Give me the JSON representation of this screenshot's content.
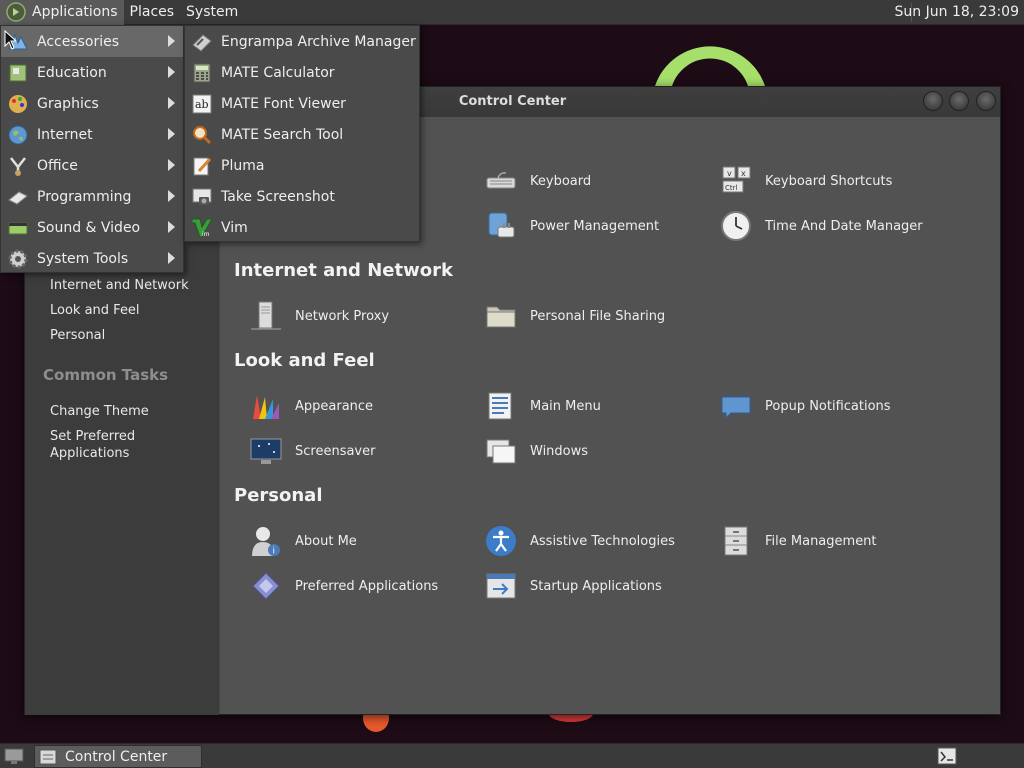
{
  "top_panel": {
    "menus": [
      "Applications",
      "Places",
      "System"
    ],
    "clock": "Sun Jun 18, 23:09"
  },
  "app_menu": {
    "items": [
      {
        "label": "Accessories",
        "icon": "accessories-icon"
      },
      {
        "label": "Education",
        "icon": "education-icon"
      },
      {
        "label": "Graphics",
        "icon": "graphics-icon"
      },
      {
        "label": "Internet",
        "icon": "internet-icon"
      },
      {
        "label": "Office",
        "icon": "office-icon"
      },
      {
        "label": "Programming",
        "icon": "programming-icon"
      },
      {
        "label": "Sound & Video",
        "icon": "sound-video-icon"
      },
      {
        "label": "System Tools",
        "icon": "system-tools-icon"
      }
    ],
    "active": "Accessories"
  },
  "accessories_menu": {
    "items": [
      {
        "label": "Engrampa Archive Manager",
        "icon": "archive-manager-icon"
      },
      {
        "label": "MATE Calculator",
        "icon": "calculator-icon"
      },
      {
        "label": "MATE Font Viewer",
        "icon": "font-viewer-icon"
      },
      {
        "label": "MATE Search Tool",
        "icon": "search-tool-icon"
      },
      {
        "label": "Pluma",
        "icon": "text-editor-icon"
      },
      {
        "label": "Take Screenshot",
        "icon": "screenshot-icon"
      },
      {
        "label": "Vim",
        "icon": "vim-icon"
      }
    ]
  },
  "control_center": {
    "title": "Control Center",
    "sidebar": {
      "groups_items": [
        "Internet and Network",
        "Look and Feel",
        "Personal"
      ],
      "common_tasks_heading": "Common Tasks",
      "tasks": [
        "Change Theme",
        "Set Preferred Applications"
      ]
    },
    "sections": [
      {
        "heading": "",
        "items": [
          {
            "label": "Keyboard",
            "icon": "keyboard-icon"
          },
          {
            "label": "Keyboard Shortcuts",
            "icon": "keyboard-shortcuts-icon"
          },
          {
            "label": "Power Management",
            "icon": "power-management-icon"
          },
          {
            "label": "Time And Date Manager",
            "icon": "clock-icon"
          }
        ]
      },
      {
        "heading": "Internet and Network",
        "items": [
          {
            "label": "Network Proxy",
            "icon": "network-proxy-icon"
          },
          {
            "label": "Personal File Sharing",
            "icon": "file-sharing-icon"
          }
        ]
      },
      {
        "heading": "Look and Feel",
        "items": [
          {
            "label": "Appearance",
            "icon": "appearance-icon"
          },
          {
            "label": "Main Menu",
            "icon": "main-menu-icon"
          },
          {
            "label": "Popup Notifications",
            "icon": "notifications-icon"
          },
          {
            "label": "Screensaver",
            "icon": "screensaver-icon"
          },
          {
            "label": "Windows",
            "icon": "windows-icon"
          }
        ]
      },
      {
        "heading": "Personal",
        "items": [
          {
            "label": "About Me",
            "icon": "about-me-icon"
          },
          {
            "label": "Assistive Technologies",
            "icon": "accessibility-icon"
          },
          {
            "label": "File Management",
            "icon": "file-management-icon"
          },
          {
            "label": "Preferred Applications",
            "icon": "preferred-apps-icon"
          },
          {
            "label": "Startup Applications",
            "icon": "startup-apps-icon"
          }
        ]
      }
    ]
  },
  "taskbar": {
    "window_button": "Control Center"
  }
}
